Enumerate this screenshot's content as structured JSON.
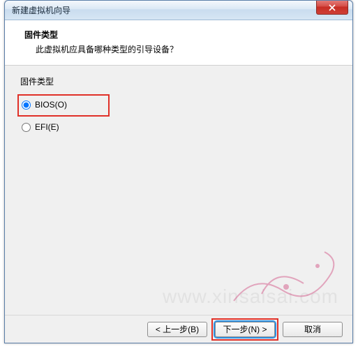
{
  "window": {
    "title": "新建虚拟机向导"
  },
  "header": {
    "title": "固件类型",
    "subtitle": "此虚拟机应具备哪种类型的引导设备？"
  },
  "group": {
    "label": "固件类型"
  },
  "options": {
    "bios": "BIOS(O)",
    "efi": "EFI(E)"
  },
  "buttons": {
    "back": "< 上一步(B)",
    "next": "下一步(N) >",
    "cancel": "取消"
  },
  "watermark": "www.xinsaisai.com"
}
